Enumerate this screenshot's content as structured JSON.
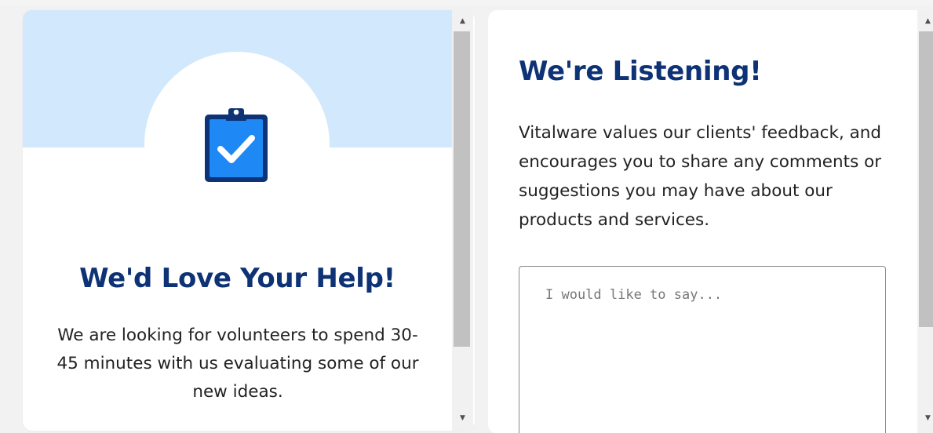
{
  "left_card": {
    "title": "We'd Love Your Help!",
    "body": "We are looking for volunteers to spend 30-45 minutes with us evaluating some of our new ideas.",
    "icon": "clipboard-check-icon",
    "colors": {
      "band": "#d2e8fd",
      "icon_fill": "#1e88f5",
      "icon_outline": "#0d3275",
      "title": "#0d3275"
    }
  },
  "right_card": {
    "title": "We're Listening!",
    "body": "Vitalware values our clients' feedback, and encourages you to share any comments or suggestions you may have about our products and services.",
    "feedback": {
      "value": "",
      "placeholder": "I would like to say..."
    }
  },
  "scrollbars": {
    "up_arrow": "▲",
    "down_arrow": "▼"
  }
}
